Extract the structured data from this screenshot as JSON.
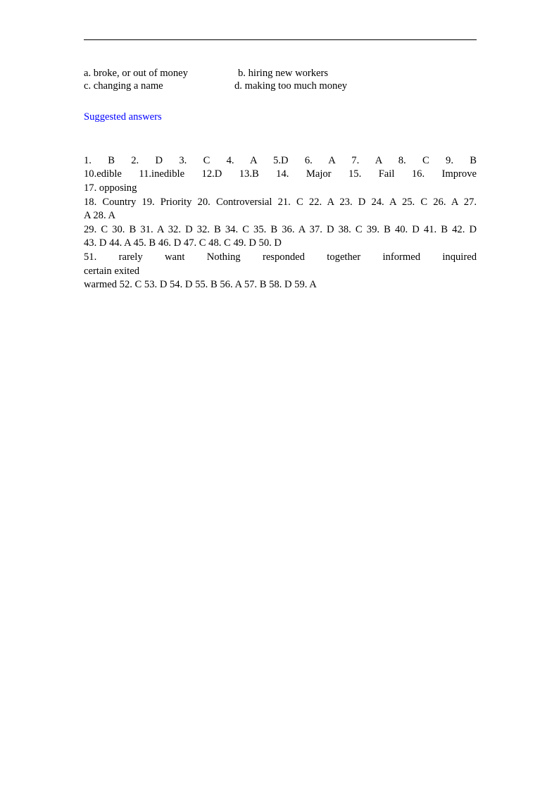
{
  "document": {
    "page_background": "#ffffff",
    "text_color": "#000000",
    "heading_color": "#0000ff"
  },
  "divider": {
    "name": "top-horizontal-rule"
  },
  "question_options": {
    "rows": [
      {
        "left": "a. broke, or out of money",
        "right": "b. hiring new workers"
      },
      {
        "left": "c. changing a name",
        "right": "d. making too much money"
      }
    ]
  },
  "suggested_answers": {
    "heading": "Suggested answers",
    "lines": [
      {
        "id": "answers-line-1",
        "text": "1. B 2. D 3. C 4. A   5.D 6. A 7. A 8. C 9. B",
        "justified": false
      },
      {
        "id": "answers-line-2",
        "text": "10.edible    11.inedible        12.D       13.B       14.  Major       15.  Fail    16.  Improve",
        "justified": true
      },
      {
        "id": "answers-line-3",
        "text": "17. opposing",
        "justified": false
      },
      {
        "id": "answers-line-4",
        "text": "18. Country     19. Priority      20. Controversial 21. C 22. A 23. D 24. A 25. C 26. A 27.",
        "justified": true
      },
      {
        "id": "answers-line-5",
        "text": "A 28. A",
        "justified": false
      },
      {
        "id": "answers-line-6",
        "text": "29. C 30. B 31. A 32. D 32. B 34. C 35. B 36. A 37. D 38. C 39. B 40. D 41. B 42. D",
        "justified": true
      },
      {
        "id": "answers-line-7",
        "text": "43. D 44. A 45. B 46. D 47. C 48. C 49. D 50. D",
        "justified": false
      },
      {
        "id": "answers-line-8",
        "text": "51.  rarely      want         Nothing      responded      together     informed        inquired",
        "justified": true
      },
      {
        "id": "answers-line-9",
        "text": "certain    exited",
        "justified": false
      },
      {
        "id": "answers-line-10",
        "text": "warmed      52. C 53. D 54. D 55. B    56. A 57. B 58. D 59. A",
        "justified": false
      }
    ]
  }
}
